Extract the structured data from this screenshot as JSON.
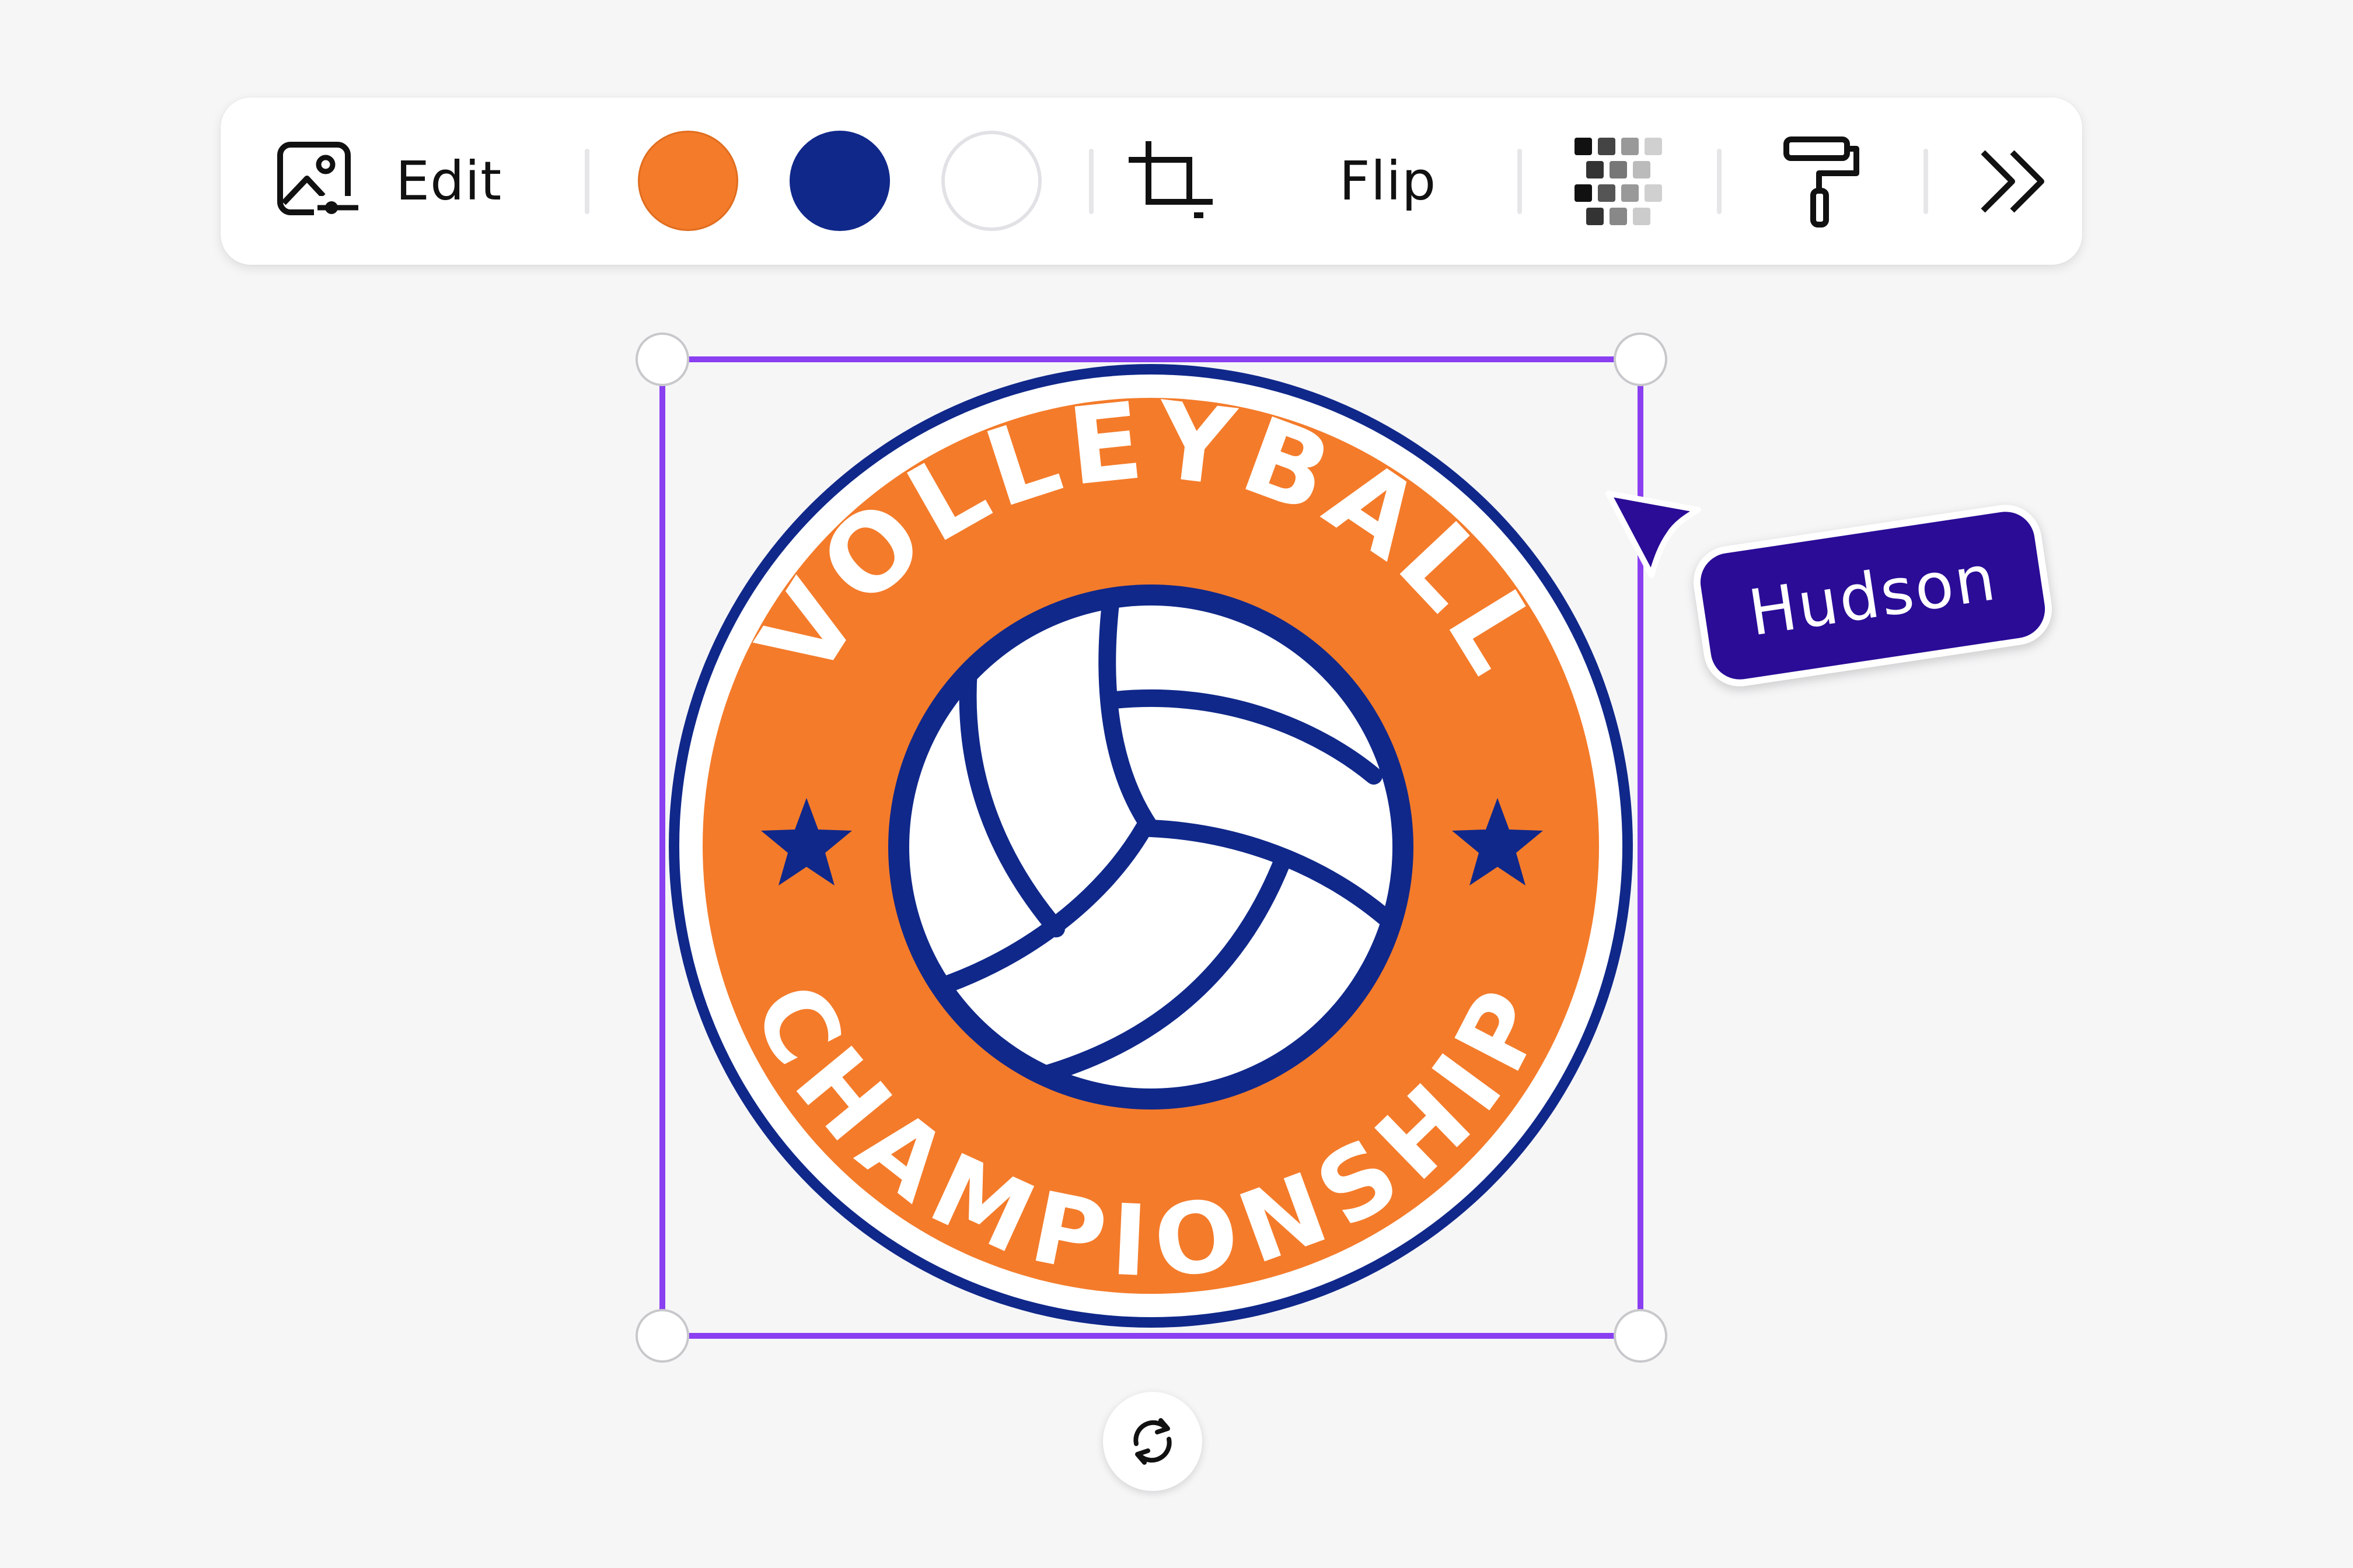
{
  "toolbar": {
    "edit_label": "Edit",
    "flip_label": "Flip",
    "icons": [
      "edit-image-icon",
      "crop-icon",
      "transparency-icon",
      "paint-roller-icon",
      "double-chevron-right-icon"
    ],
    "swatches": [
      {
        "name": "orange",
        "color": "#f47b2a"
      },
      {
        "name": "navy",
        "color": "#10288a"
      },
      {
        "name": "white",
        "color": "#ffffff"
      }
    ]
  },
  "logo": {
    "top_text": "VOLLEYBALL",
    "bottom_text": "CHAMPIONSHIP",
    "colors": {
      "orange": "#f47b2a",
      "navy": "#10288a",
      "white": "#ffffff"
    }
  },
  "selection": {
    "border_color": "#8a3ff1"
  },
  "collaborator": {
    "name": "Hudson",
    "color": "#2a0c97"
  },
  "rotate_icon": "rotate-icon"
}
